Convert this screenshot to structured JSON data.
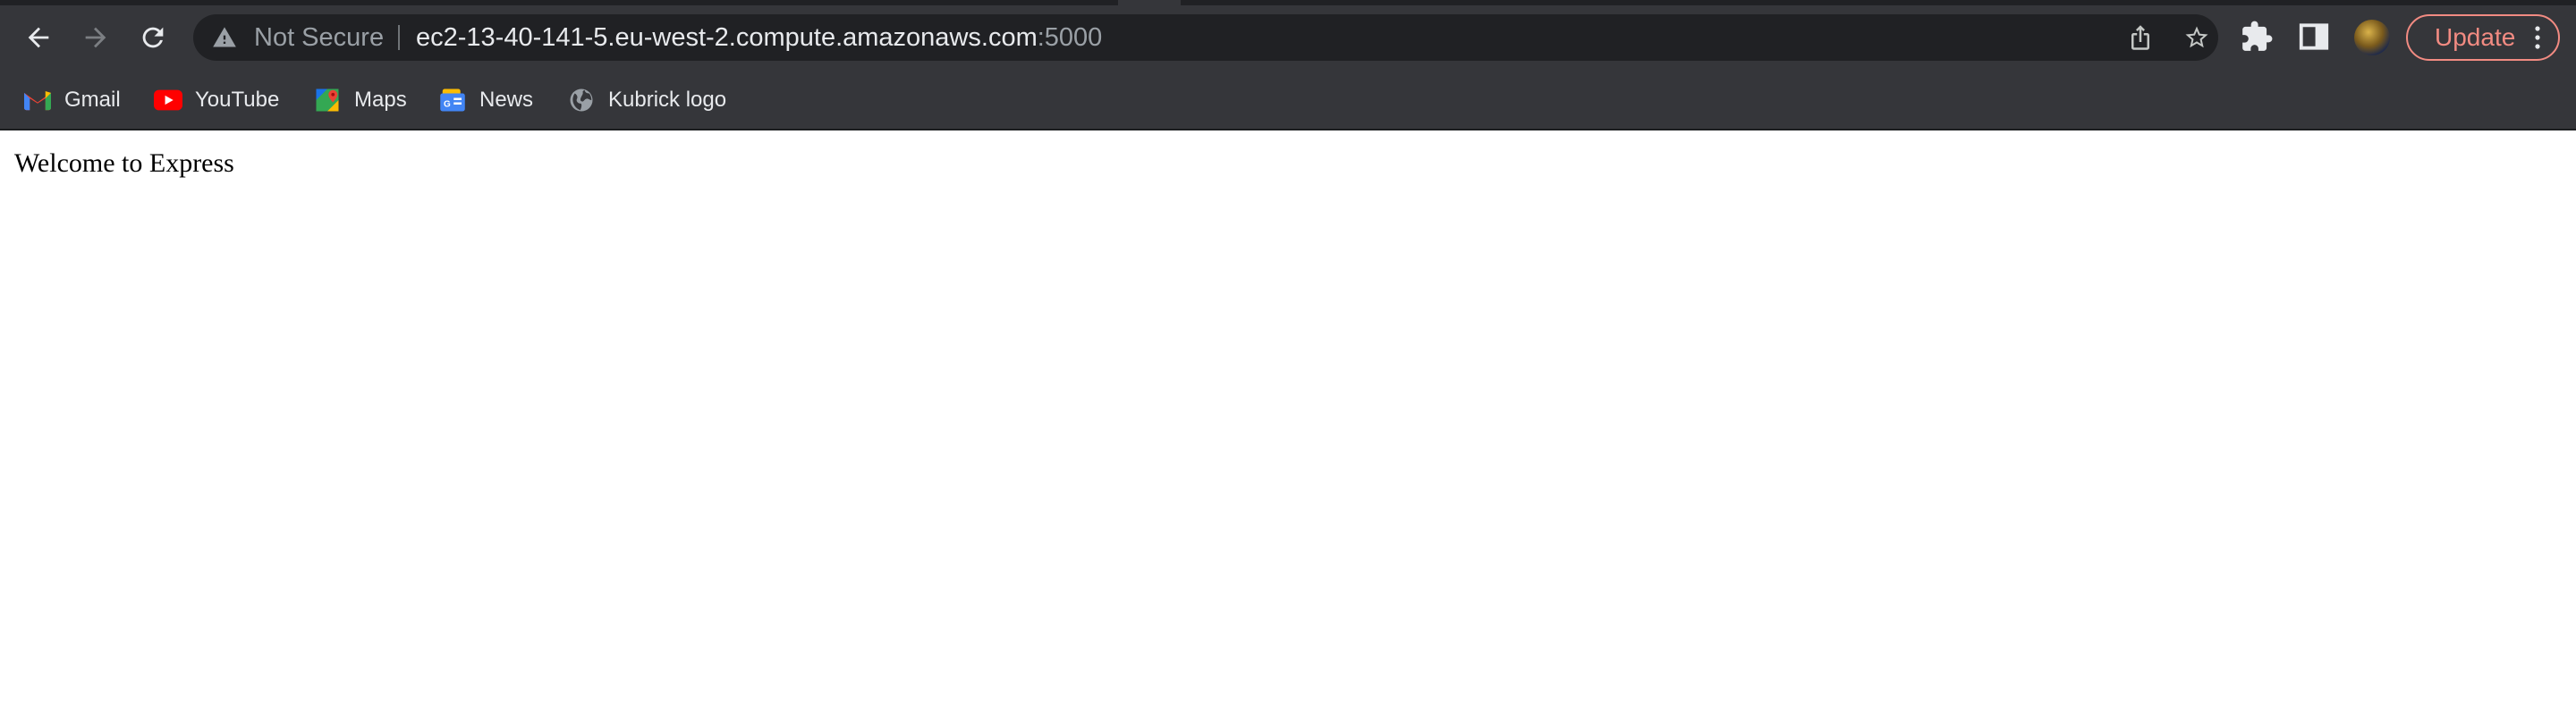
{
  "toolbar": {
    "back_icon": "arrow-left-icon",
    "forward_icon": "arrow-right-icon",
    "reload_icon": "reload-icon"
  },
  "omnibox": {
    "security_label": "Not Secure",
    "url_host": "ec2-13-40-141-5.eu-west-2.compute.amazonaws.com",
    "url_port": ":5000",
    "share_icon": "share-icon",
    "bookmark_icon": "star-icon"
  },
  "actions": {
    "extensions_icon": "puzzle-icon",
    "side_panel_icon": "side-panel-icon",
    "update_label": "Update",
    "menu_icon": "three-dots-vertical-icon"
  },
  "bookmarks": [
    {
      "label": "Gmail",
      "icon": "gmail-icon"
    },
    {
      "label": "YouTube",
      "icon": "youtube-icon"
    },
    {
      "label": "Maps",
      "icon": "maps-icon"
    },
    {
      "label": "News",
      "icon": "google-news-icon"
    },
    {
      "label": "Kubrick logo",
      "icon": "globe-icon"
    }
  ],
  "page": {
    "heading_text": "Welcome to Express"
  },
  "colors": {
    "chrome_bg": "#35363a",
    "omnibox_bg": "#202124",
    "update_accent": "#f28b82",
    "text_light": "#e8eaed",
    "text_dim": "#9aa0a6"
  }
}
